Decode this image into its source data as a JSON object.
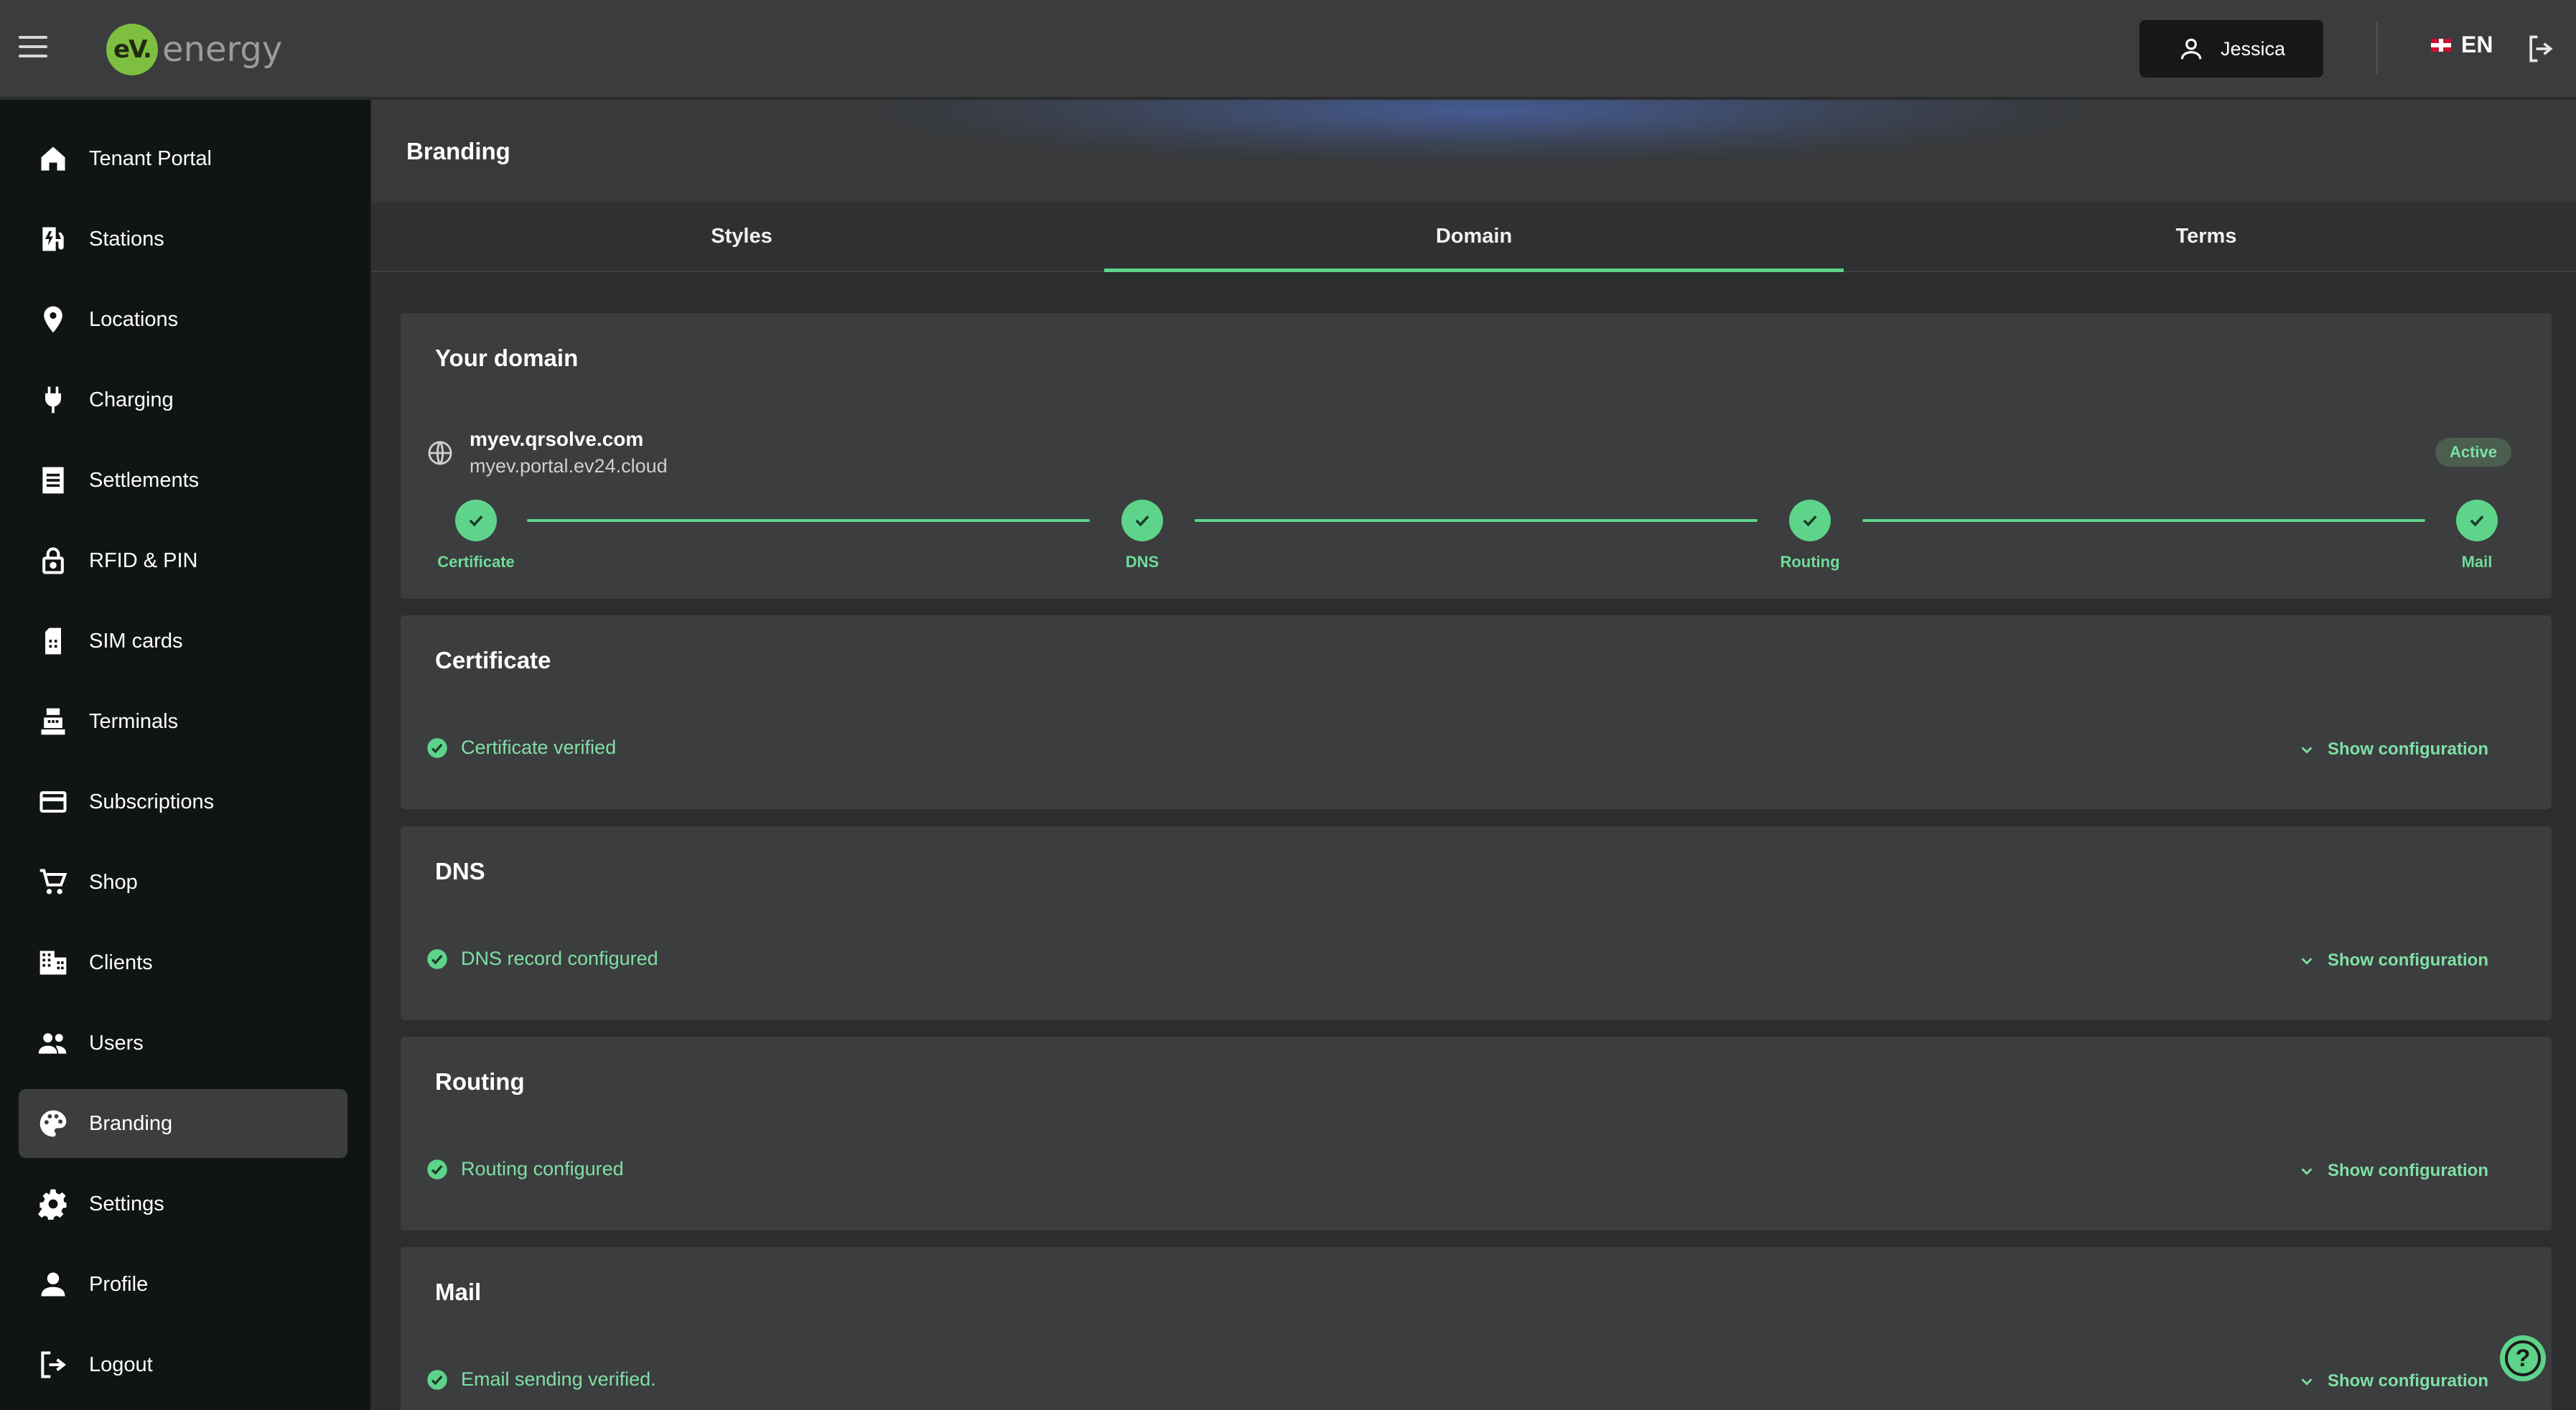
{
  "header": {
    "logo_badge": "eV.",
    "logo_text": "energy",
    "user_name": "Jessica",
    "language": "EN"
  },
  "sidebar": {
    "items": [
      {
        "label": "Tenant Portal",
        "icon": "home-icon"
      },
      {
        "label": "Stations",
        "icon": "ev-station-icon"
      },
      {
        "label": "Locations",
        "icon": "location-pin-icon"
      },
      {
        "label": "Charging",
        "icon": "plug-icon"
      },
      {
        "label": "Settlements",
        "icon": "receipt-icon"
      },
      {
        "label": "RFID & PIN",
        "icon": "lock-icon"
      },
      {
        "label": "SIM cards",
        "icon": "sim-card-icon"
      },
      {
        "label": "Terminals",
        "icon": "terminal-icon"
      },
      {
        "label": "Subscriptions",
        "icon": "credit-card-icon"
      },
      {
        "label": "Shop",
        "icon": "cart-icon"
      },
      {
        "label": "Clients",
        "icon": "building-icon"
      },
      {
        "label": "Users",
        "icon": "users-icon"
      },
      {
        "label": "Branding",
        "icon": "palette-icon",
        "active": true
      },
      {
        "label": "Settings",
        "icon": "gear-icon"
      },
      {
        "label": "Profile",
        "icon": "person-icon"
      },
      {
        "label": "Logout",
        "icon": "logout-icon"
      }
    ]
  },
  "page": {
    "title": "Branding",
    "tabs": [
      {
        "label": "Styles"
      },
      {
        "label": "Domain",
        "active": true
      },
      {
        "label": "Terms"
      }
    ]
  },
  "domain_card": {
    "title": "Your domain",
    "primary_domain": "myev.qrsolve.com",
    "secondary_domain": "myev.portal.ev24.cloud",
    "status": "Active",
    "steps": [
      "Certificate",
      "DNS",
      "Routing",
      "Mail"
    ]
  },
  "sections": [
    {
      "title": "Certificate",
      "status": "Certificate verified",
      "action": "Show configuration"
    },
    {
      "title": "DNS",
      "status": "DNS record configured",
      "action": "Show configuration"
    },
    {
      "title": "Routing",
      "status": "Routing configured",
      "action": "Show configuration"
    },
    {
      "title": "Mail",
      "status": "Email sending verified.",
      "action": "Show configuration"
    }
  ],
  "help": {
    "label": "?"
  },
  "colors": {
    "accent_green": "#5dd48a",
    "sidebar_bg": "#101413",
    "card_bg": "#3c3d3f",
    "topbar_bg": "#3b3c3e"
  }
}
